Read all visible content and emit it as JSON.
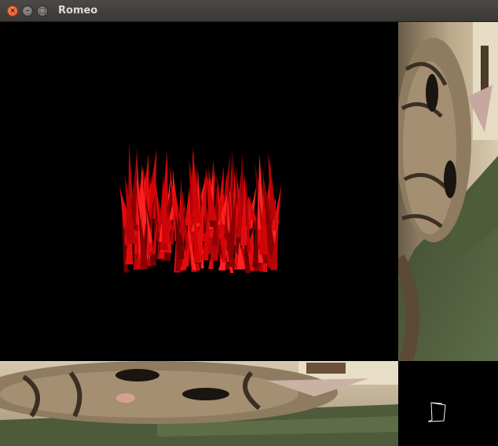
{
  "window": {
    "title": "Romeo",
    "buttons": {
      "close_icon": "×",
      "minimize_icon": "–",
      "maximize_icon": "□"
    }
  },
  "colors": {
    "titlebar": "#3c3b37",
    "close_button": "#e95420",
    "render_background": "#000000",
    "grass": "#c8070a",
    "fur_light": "#b9a58a",
    "fur_dark": "#3a2f22",
    "couch_green": "#4b5a3a"
  },
  "viewports": [
    {
      "name": "main-3d-view",
      "content": "red-grass-object"
    },
    {
      "name": "camera-feed-rotated",
      "content": "kitten"
    },
    {
      "name": "camera-feed-bottom",
      "content": "kitten"
    },
    {
      "name": "minimap",
      "content": "wireframe-outline"
    }
  ]
}
